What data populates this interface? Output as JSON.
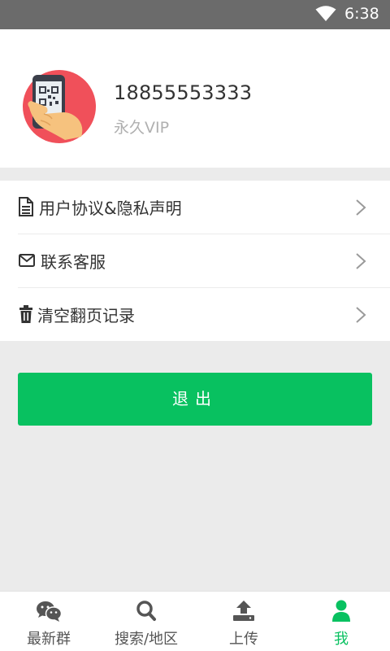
{
  "status_bar": {
    "time": "6:38"
  },
  "profile": {
    "username": "18855553333",
    "membership": "永久VIP"
  },
  "menu": {
    "items": [
      {
        "label": "用户协议&隐私声明",
        "icon": "document-icon"
      },
      {
        "label": "联系客服",
        "icon": "mail-icon"
      },
      {
        "label": "清空翻页记录",
        "icon": "trash-icon"
      }
    ]
  },
  "logout": {
    "label": "退出"
  },
  "tabbar": {
    "tabs": [
      {
        "label": "最新群",
        "icon": "wechat-icon"
      },
      {
        "label": "搜索/地区",
        "icon": "search-icon"
      },
      {
        "label": "上传",
        "icon": "upload-icon"
      },
      {
        "label": "我",
        "icon": "user-icon",
        "active": true
      }
    ]
  },
  "colors": {
    "accent": "#08c160",
    "status_bar": "#6b6b6b",
    "background": "#ebebeb"
  }
}
